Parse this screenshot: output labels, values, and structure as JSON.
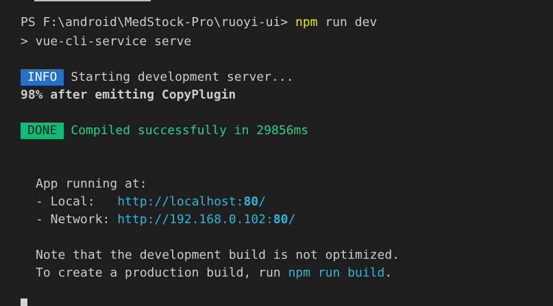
{
  "prompt": {
    "prefix": "PS F:\\android\\MedStock-Pro\\ruoyi-ui> ",
    "command": "npm",
    "args": " run dev"
  },
  "script_line": "> vue-cli-service serve",
  "info": {
    "badge": "INFO",
    "text": "Starting development server..."
  },
  "progress_line": "98% after emitting CopyPlugin",
  "done": {
    "badge": "DONE",
    "text": "Compiled successfully in 29856ms"
  },
  "app_running": {
    "heading": "App running at:",
    "local_label": "- Local:   ",
    "local_url": "http://localhost:",
    "local_port": "80",
    "local_suffix": "/",
    "network_label": "- Network: ",
    "network_url": "http://192.168.0.102:",
    "network_port": "80",
    "network_suffix": "/"
  },
  "notes": {
    "line1": "Note that the development build is not optimized.",
    "line2_prefix": "To create a production build, run ",
    "line2_command": "npm run build",
    "line2_suffix": "."
  },
  "colors": {
    "background": "#1e1e1e",
    "text": "#cccccc",
    "command_yellow": "#e5e510",
    "info_blue": "#2472c8",
    "done_green": "#0dbc79",
    "success_green": "#23d18b",
    "url_cyan": "#29b8db"
  },
  "icons": {
    "cursor": "block-cursor"
  }
}
